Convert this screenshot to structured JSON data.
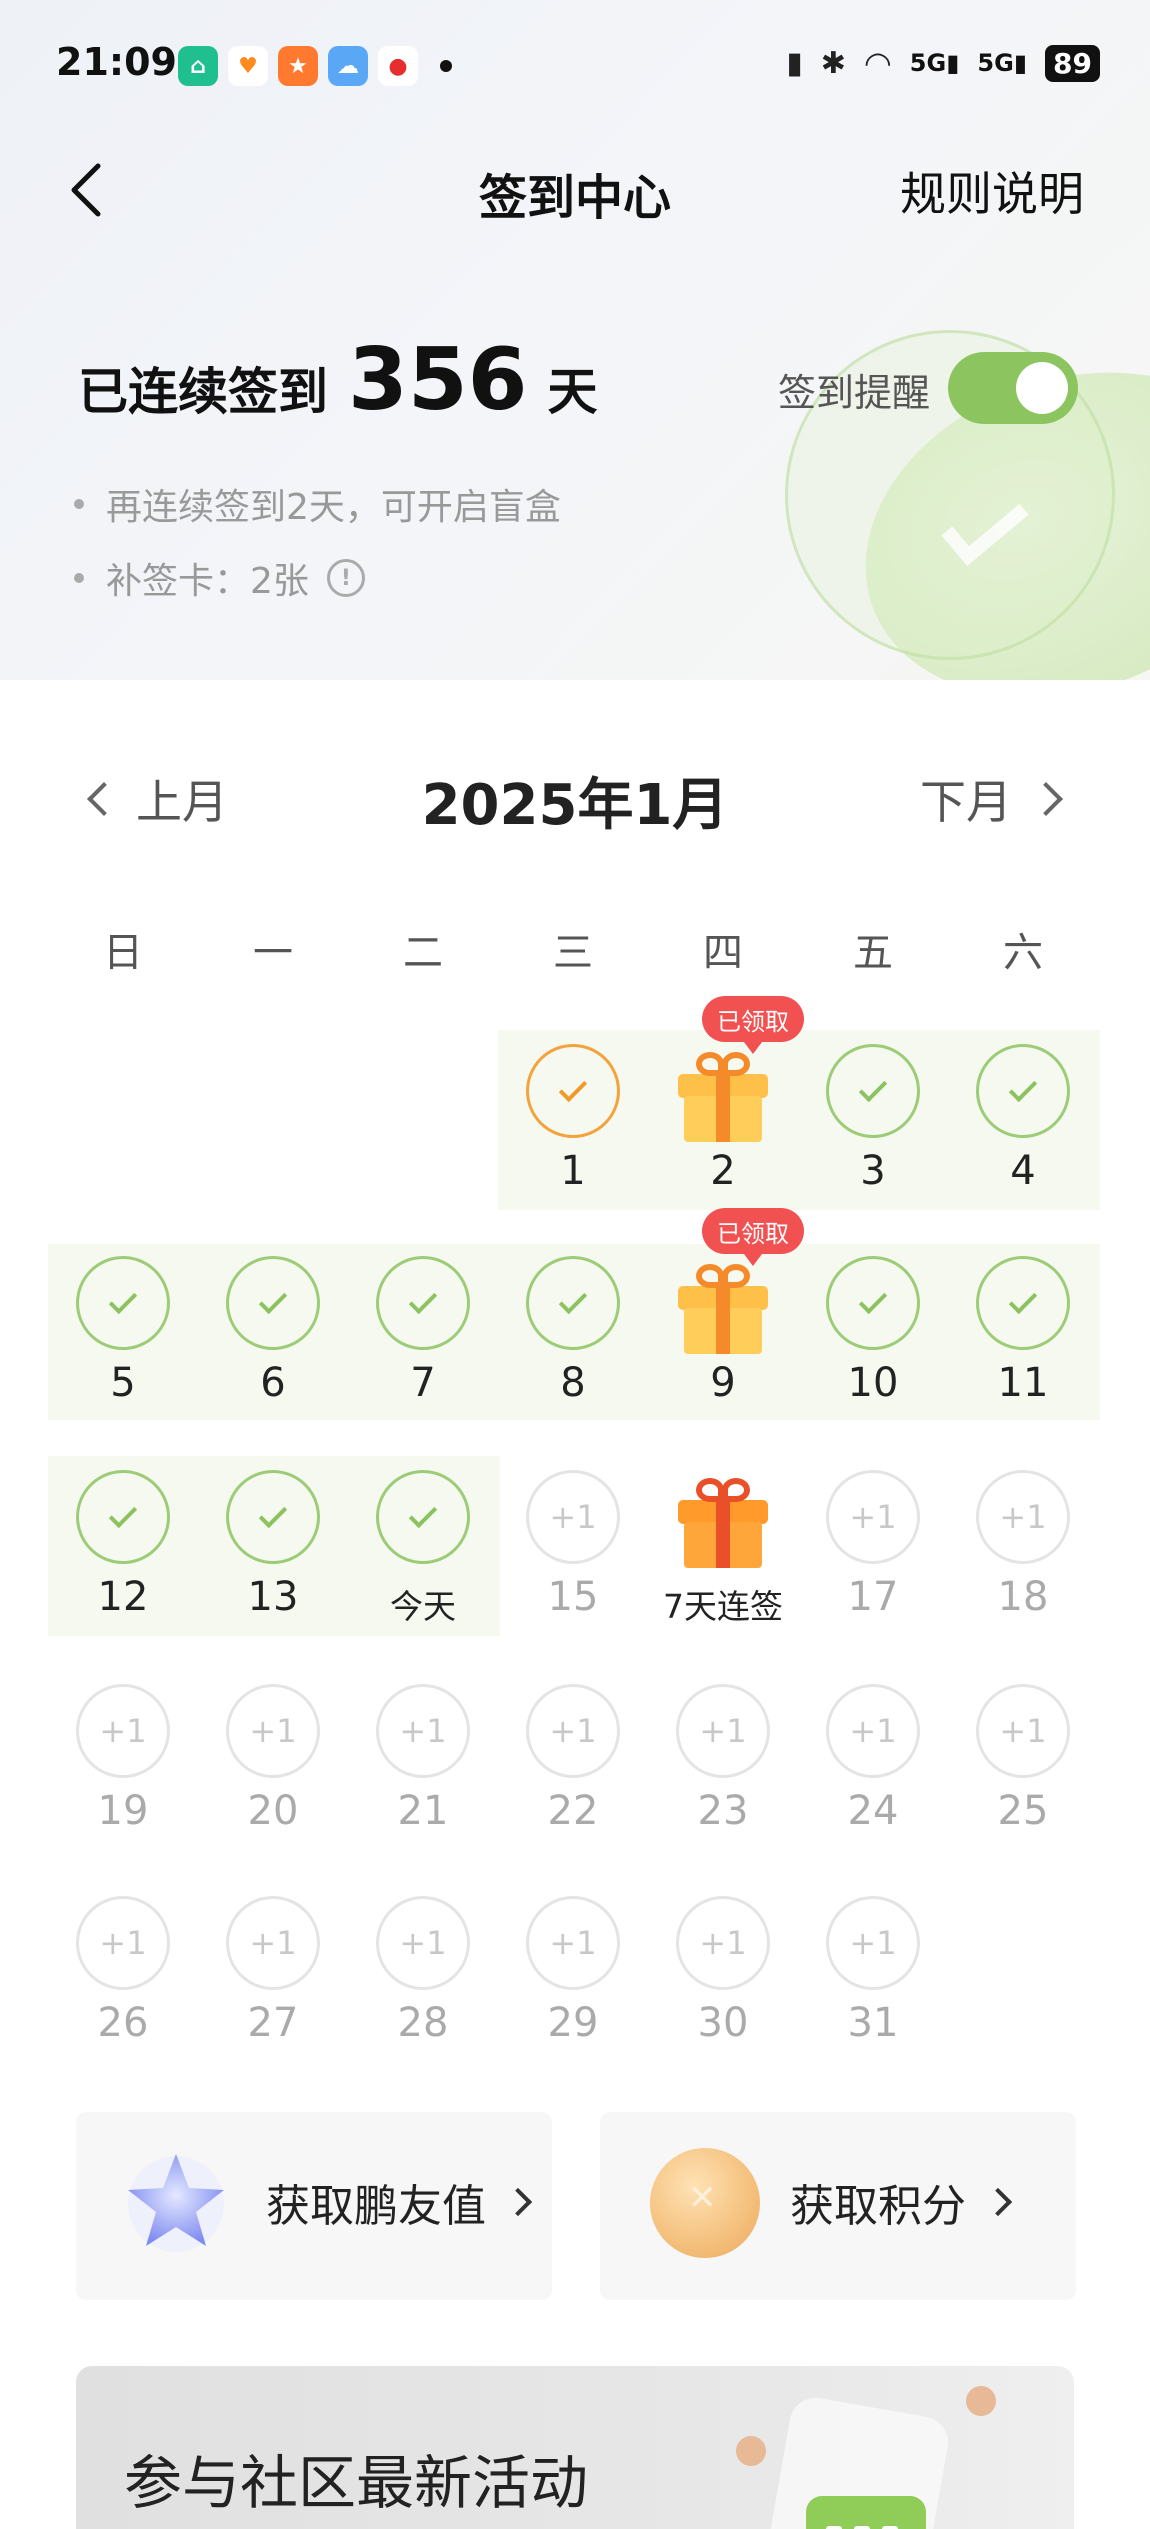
{
  "status_bar": {
    "time": "21:09",
    "signal1": "5G",
    "signal2": "5G",
    "battery": "89"
  },
  "nav": {
    "title": "签到中心",
    "rules_link": "规则说明"
  },
  "streak": {
    "prefix": "已连续签到",
    "days": "356",
    "unit": "天"
  },
  "reminder": {
    "label": "签到提醒",
    "enabled": true
  },
  "tips": [
    "再连续签到2天，可开启盲盒",
    "补签卡：2张"
  ],
  "calendar": {
    "prev_label": "上月",
    "next_label": "下月",
    "month_title": "2025年1月",
    "weekdays": [
      "日",
      "一",
      "二",
      "三",
      "四",
      "五",
      "六"
    ],
    "claimed_badge": "已领取",
    "plus_one": "+1",
    "today_label": "今天",
    "gift_label_7day": "7天连签",
    "days": {
      "d1": "1",
      "d2": "2",
      "d3": "3",
      "d4": "4",
      "d5": "5",
      "d6": "6",
      "d7": "7",
      "d8": "8",
      "d9": "9",
      "d10": "10",
      "d11": "11",
      "d12": "12",
      "d13": "13",
      "d15": "15",
      "d17": "17",
      "d18": "18",
      "d19": "19",
      "d20": "20",
      "d21": "21",
      "d22": "22",
      "d23": "23",
      "d24": "24",
      "d25": "25",
      "d26": "26",
      "d27": "27",
      "d28": "28",
      "d29": "29",
      "d30": "30",
      "d31": "31"
    }
  },
  "cards": {
    "friend_value": "获取鹏友值",
    "points": "获取积分"
  },
  "banner": {
    "line1": "参与社区最新活动"
  },
  "colors": {
    "accent_green": "#8cc560",
    "badge_red": "#f25151",
    "first_day_orange": "#f4a33c"
  }
}
